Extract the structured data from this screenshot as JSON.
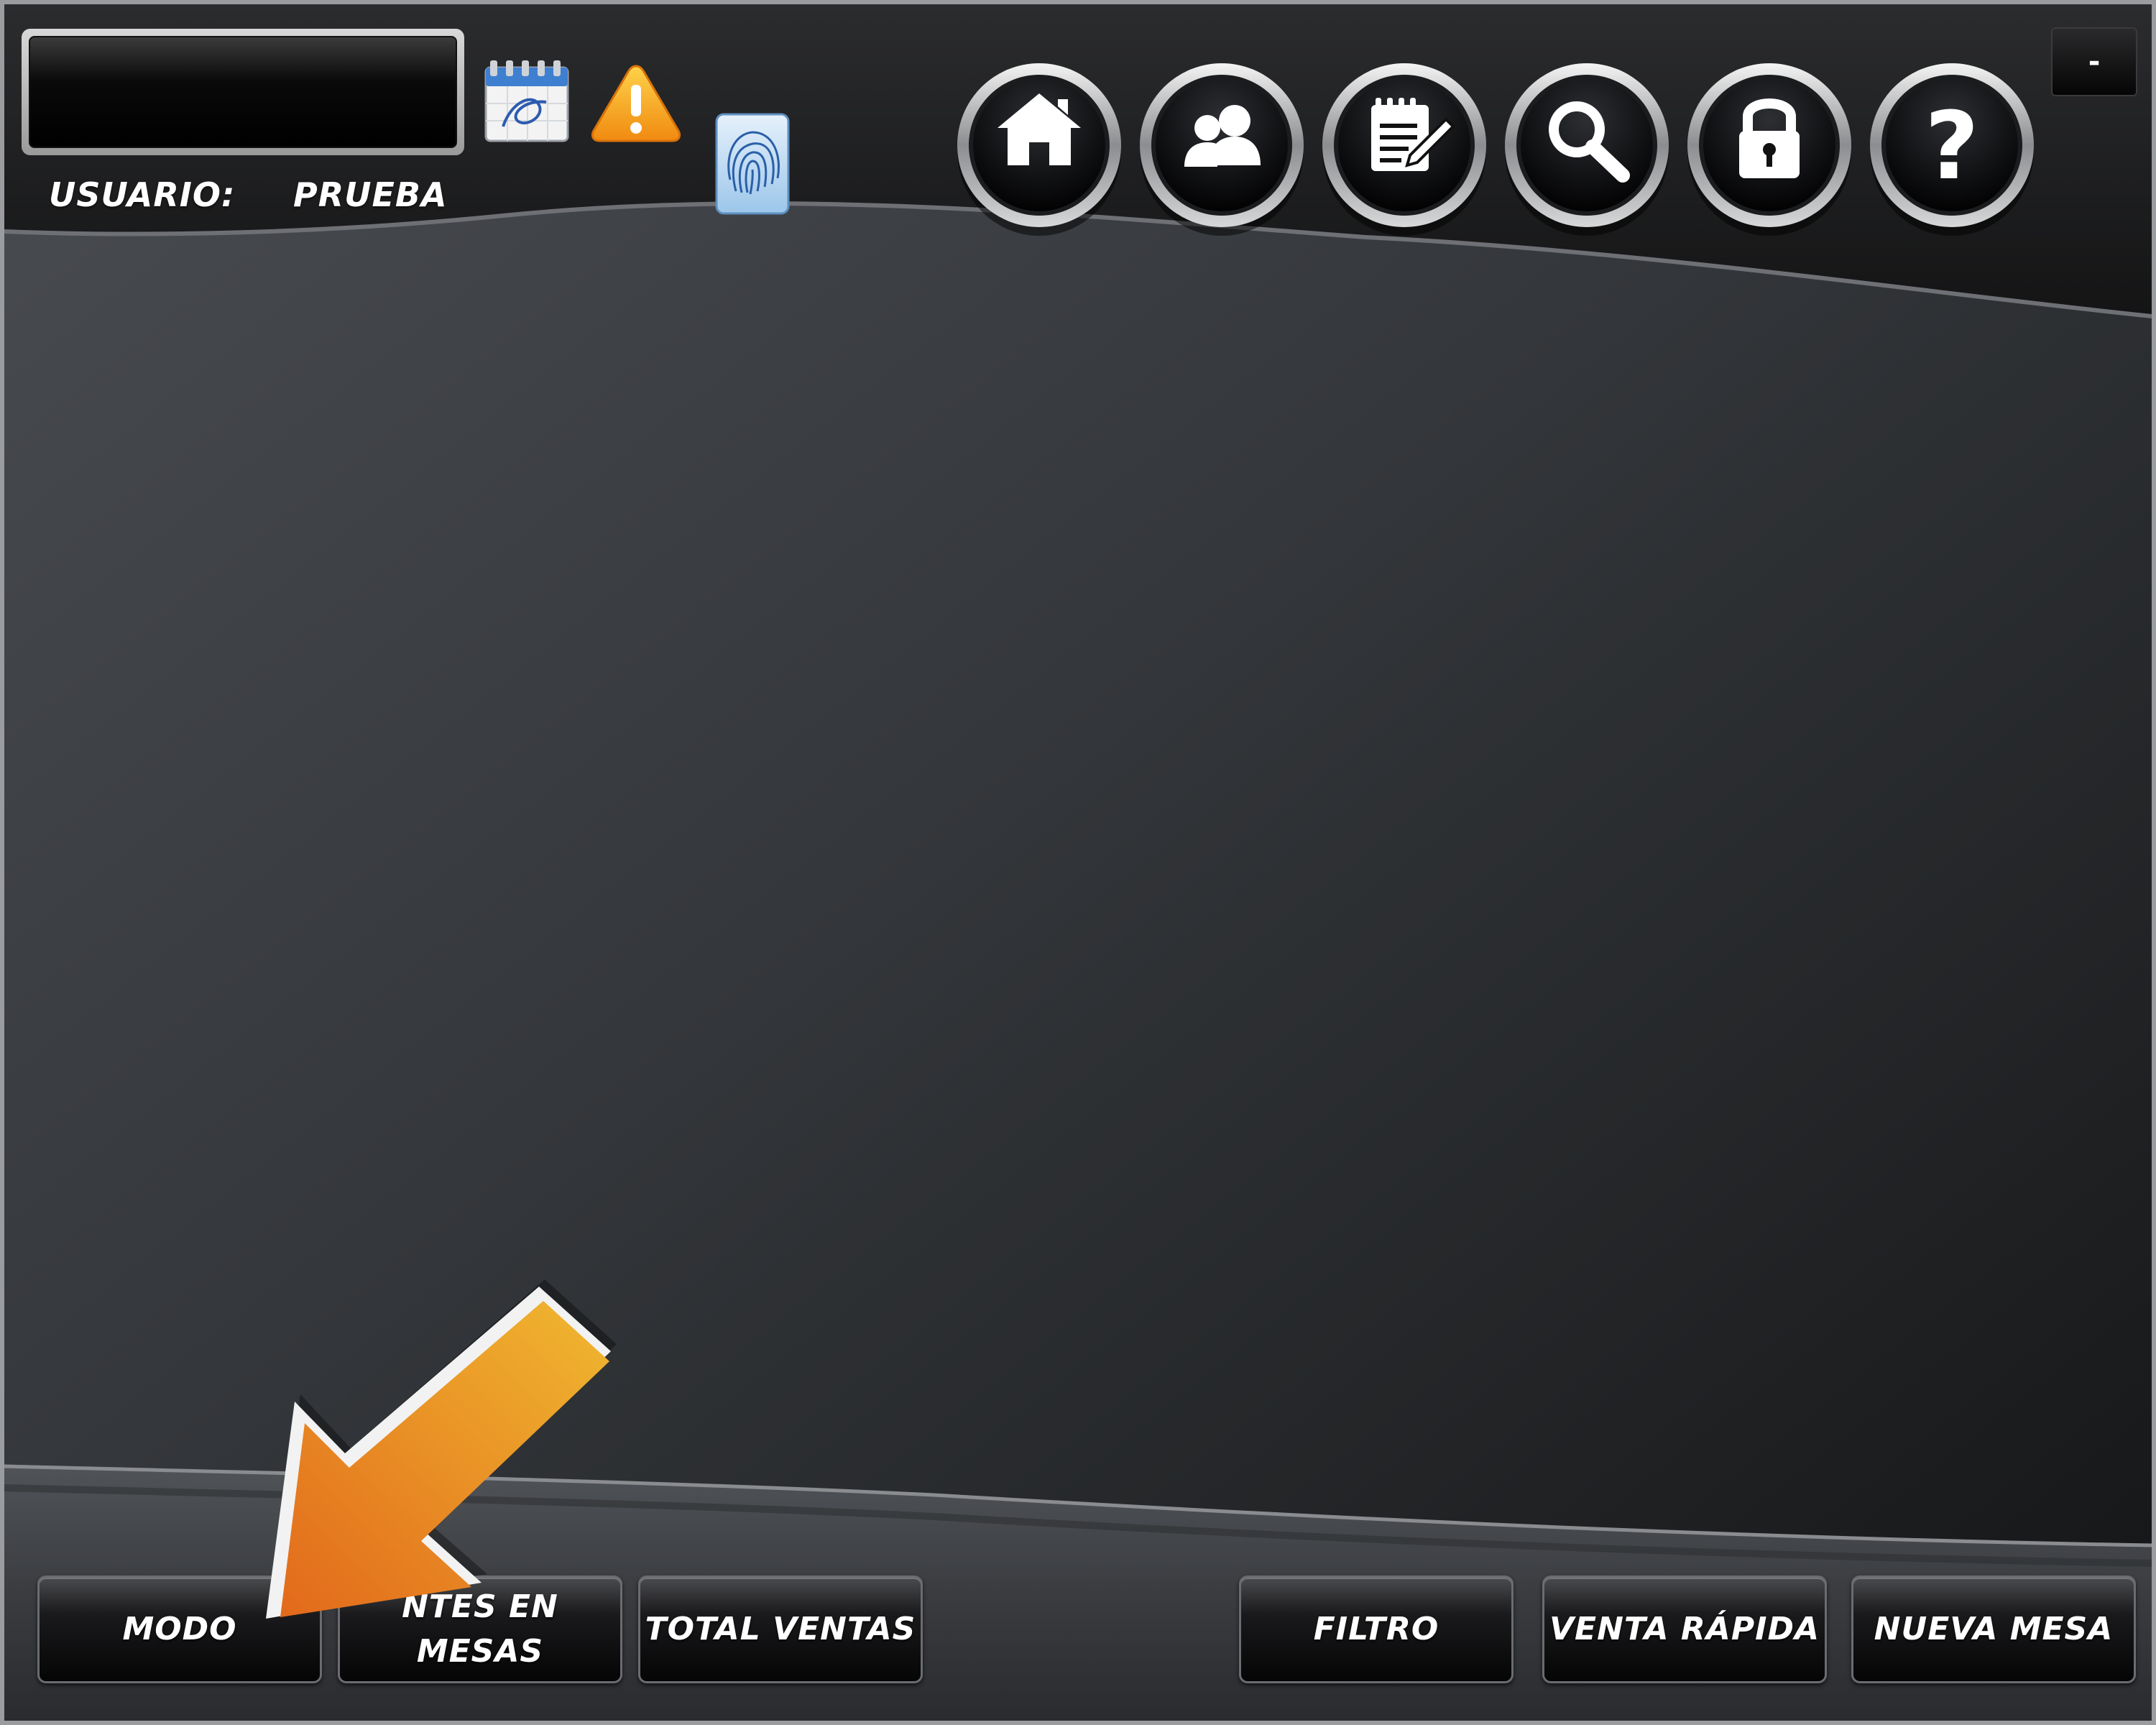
{
  "header": {
    "user_label": "USUARIO:",
    "user_value": "PRUEBA",
    "display_value": "",
    "minimize_label": "-"
  },
  "status_icons": [
    "calendar-icon",
    "warning-icon",
    "fingerprint-icon"
  ],
  "nav": [
    {
      "name": "home-icon"
    },
    {
      "name": "users-icon"
    },
    {
      "name": "notes-edit-icon"
    },
    {
      "name": "search-icon"
    },
    {
      "name": "lock-icon"
    },
    {
      "name": "help-icon"
    }
  ],
  "footer": {
    "modo": "MODO",
    "clientes_line1": "NTES EN",
    "clientes_line2": "MESAS",
    "total_ventas": "TOTAL VENTAS",
    "filtro": "FILTRO",
    "venta_rapida": "VENTA RÁPIDA",
    "nueva_mesa": "NUEVA MESA"
  },
  "colors": {
    "background": "#1a1b1d",
    "arrow_orange": "#e77a1f",
    "arrow_yellow": "#f0b52d",
    "button_border": "#6b6c70"
  }
}
